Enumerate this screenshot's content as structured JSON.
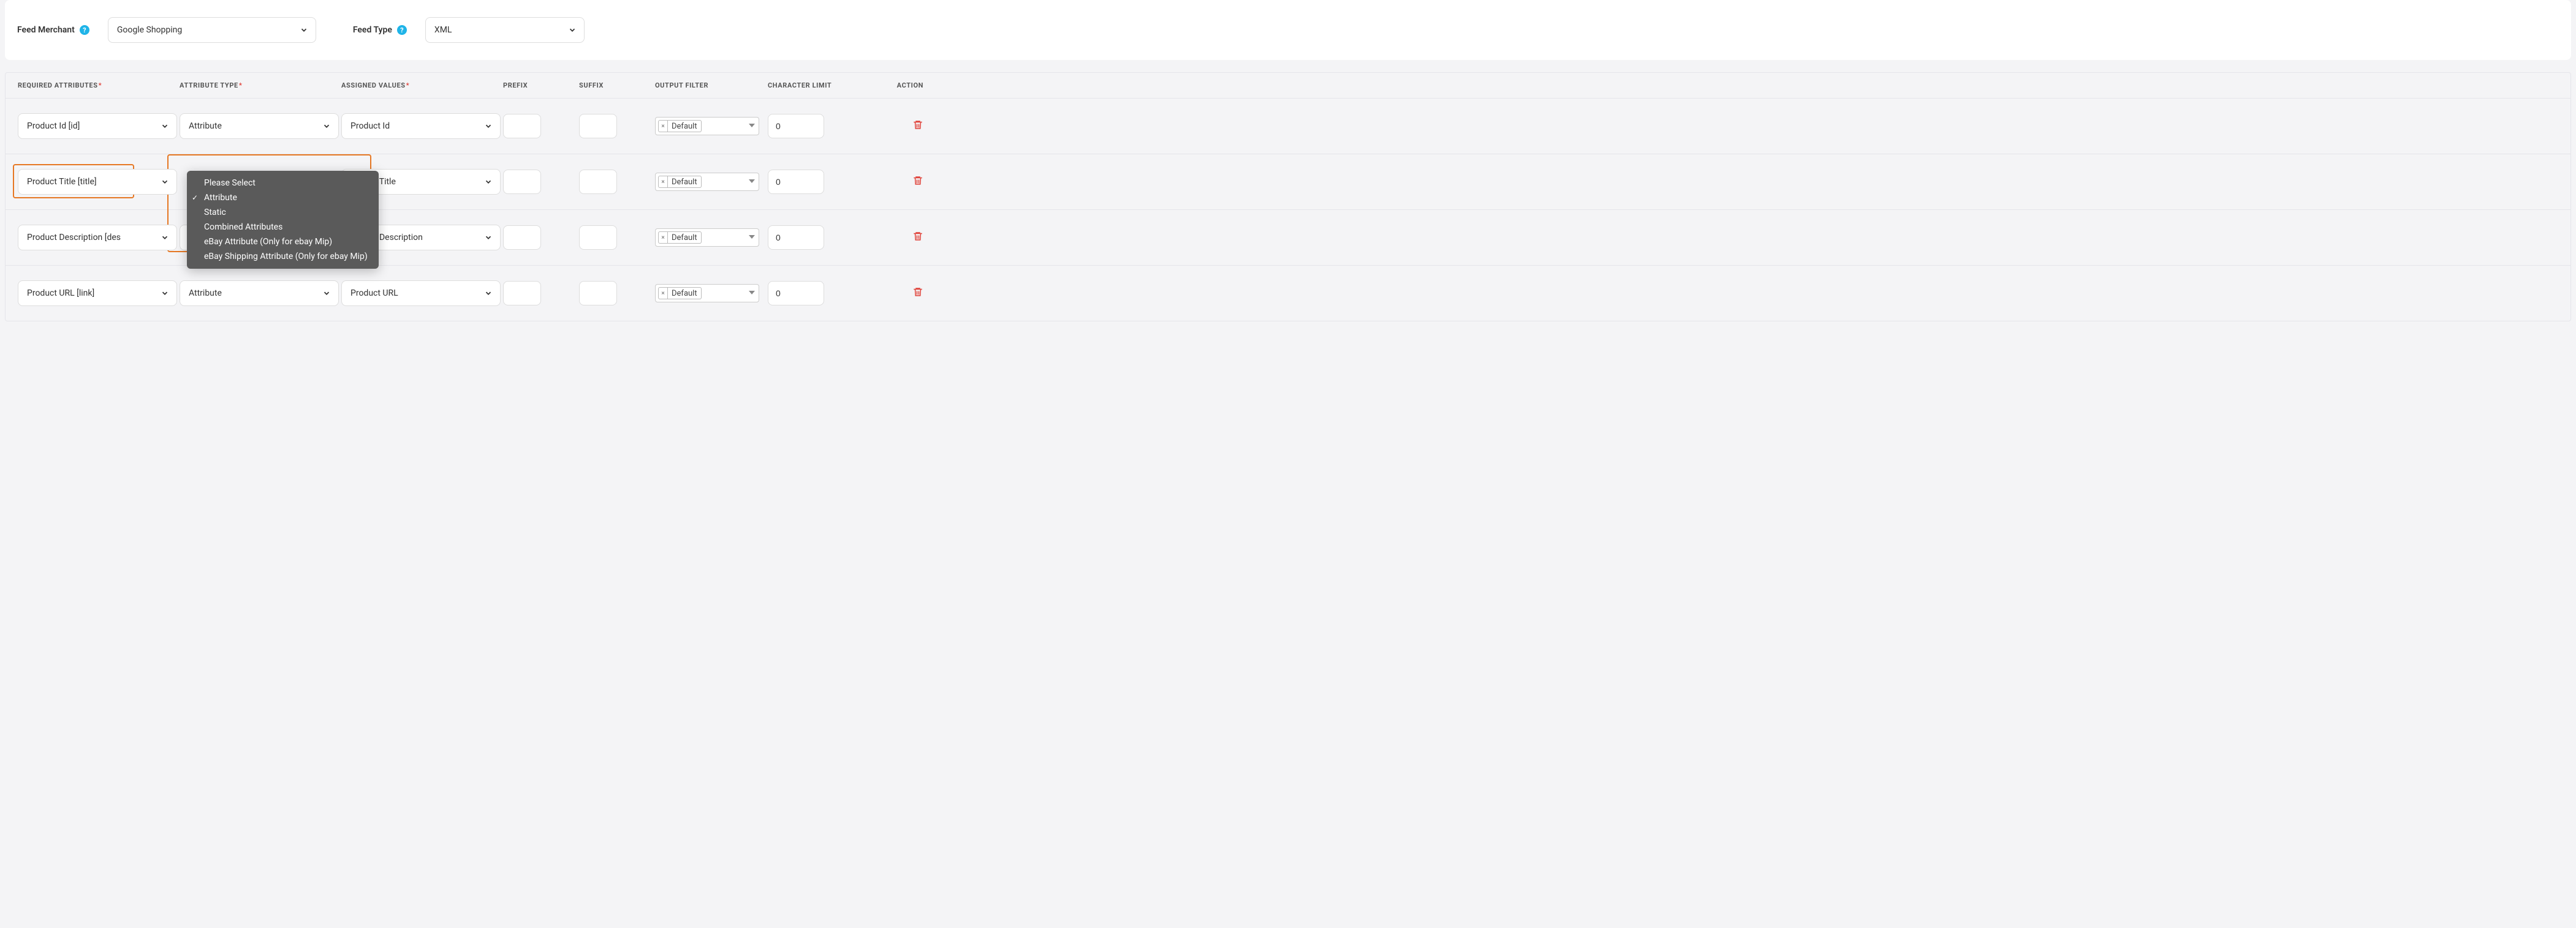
{
  "top": {
    "feed_merchant_label": "Feed Merchant",
    "feed_merchant_value": "Google Shopping",
    "feed_type_label": "Feed Type",
    "feed_type_value": "XML"
  },
  "columns": {
    "required_attributes": "REQUIRED ATTRIBUTES",
    "attribute_type": "ATTRIBUTE TYPE",
    "assigned_values": "ASSIGNED VALUES",
    "prefix": "PREFIX",
    "suffix": "SUFFIX",
    "output_filter": "OUTPUT FILTER",
    "character_limit": "CHARACTER LIMIT",
    "action": "ACTION"
  },
  "rows": [
    {
      "required": "Product Id [id]",
      "attr_type": "Attribute",
      "assigned": "Product Id",
      "filter_tag": "Default",
      "char_limit": "0"
    },
    {
      "required": "Product Title [title]",
      "attr_type": "Attribute",
      "assigned": "Product Title",
      "filter_tag": "Default",
      "char_limit": "0"
    },
    {
      "required": "Product Description [des",
      "attr_type": "Attribute",
      "assigned": "Product Description",
      "filter_tag": "Default",
      "char_limit": "0"
    },
    {
      "required": "Product URL [link]",
      "attr_type": "Attribute",
      "assigned": "Product URL",
      "filter_tag": "Default",
      "char_limit": "0"
    }
  ],
  "dropdown": {
    "header": "Please Select",
    "items": [
      "Attribute",
      "Static",
      "Combined Attributes",
      "eBay Attribute (Only for ebay Mip)",
      "eBay Shipping Attribute (Only for ebay Mip)"
    ],
    "selected_index": 0
  }
}
